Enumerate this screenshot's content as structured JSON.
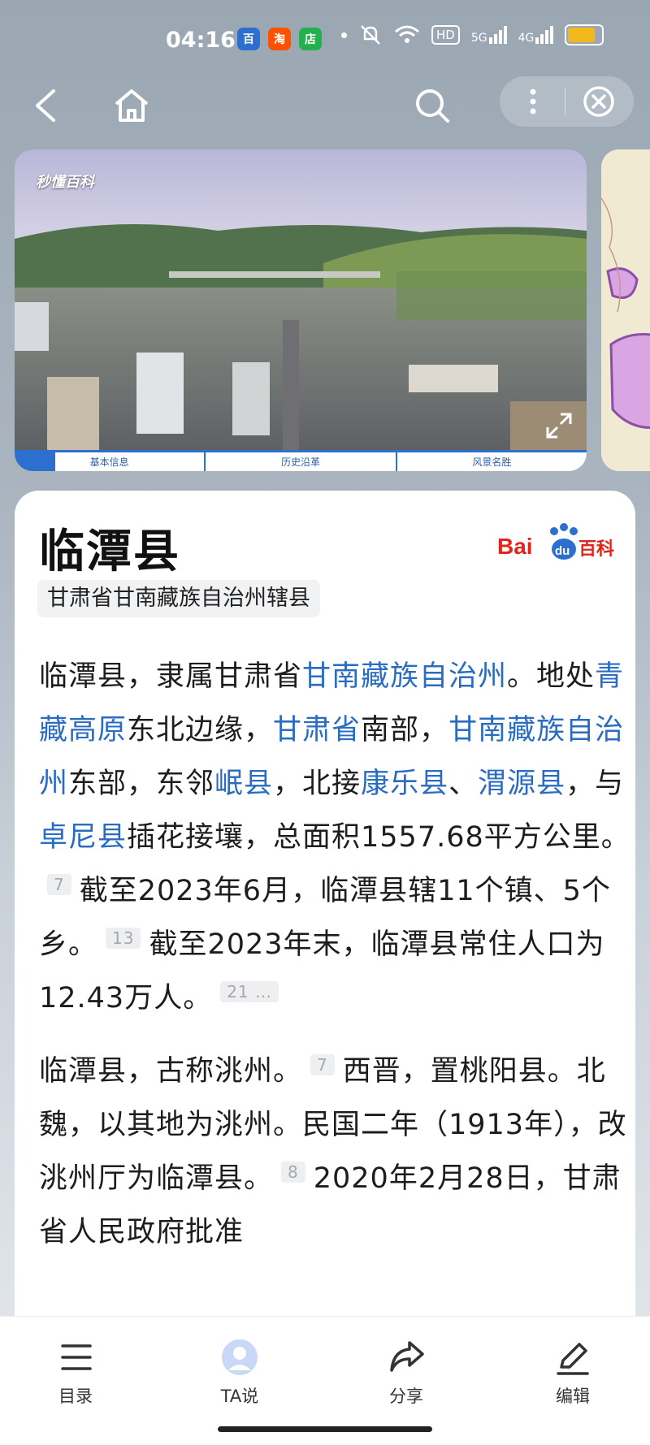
{
  "status": {
    "time": "04:16",
    "apps": [
      {
        "icon": "baidu-app-icon",
        "glyph": "百",
        "color": "#2d6fcf"
      },
      {
        "icon": "taobao-app-icon",
        "glyph": "淘",
        "color": "#ff5000"
      },
      {
        "icon": "shop-app-icon",
        "glyph": "店",
        "color": "#22b14c"
      }
    ],
    "hd": "HD",
    "net1": "5G",
    "net2": "4G",
    "battery_level": 0.9,
    "battery_color": "#f3b81c"
  },
  "media": {
    "watermark": "秒懂百科",
    "tabs": [
      "基本信息",
      "历史沿革",
      "风景名胜"
    ]
  },
  "article": {
    "title": "临潭县",
    "subtitle": "甘肃省甘南藏族自治州辖县",
    "p1": {
      "s1": "临潭县，隶属甘肃省",
      "l1": "甘南藏族自治州",
      "s2": "。地处",
      "l2": "青藏高原",
      "s3": "东北边缘，",
      "l3": "甘肃省",
      "s4": "南部，",
      "l4": "甘南藏族自治州",
      "s5": "东部，东邻",
      "l5": "岷县",
      "s6": "，北接",
      "l6": "康乐县",
      "s7": "、",
      "l7": "渭源县",
      "s8": "，与",
      "l8": "卓尼县",
      "s9": "插花接壤，总面积1557.68平方公里。",
      "r1": "7",
      "s10": "截至2023年6月，临潭县辖11个镇、5个乡。",
      "r2": "13",
      "s11": "截至2023年末，临潭县常住人口为12.43万人。",
      "r3": "21 …"
    },
    "p2": {
      "s1": "临潭县，古称洮州。",
      "r1": "7",
      "s2": "西晋，置桃阳县。北魏，以其地为洮州。民国二年（1913年），改洮州厅为临潭县。",
      "r2": "8",
      "s3": "2020年2月28日，甘肃省人民政府批准"
    }
  },
  "bottom_nav": [
    {
      "label": "目录",
      "icon": "list-icon"
    },
    {
      "label": "TA说",
      "icon": "avatar-icon"
    },
    {
      "label": "分享",
      "icon": "share-icon"
    },
    {
      "label": "编辑",
      "icon": "edit-icon"
    }
  ]
}
